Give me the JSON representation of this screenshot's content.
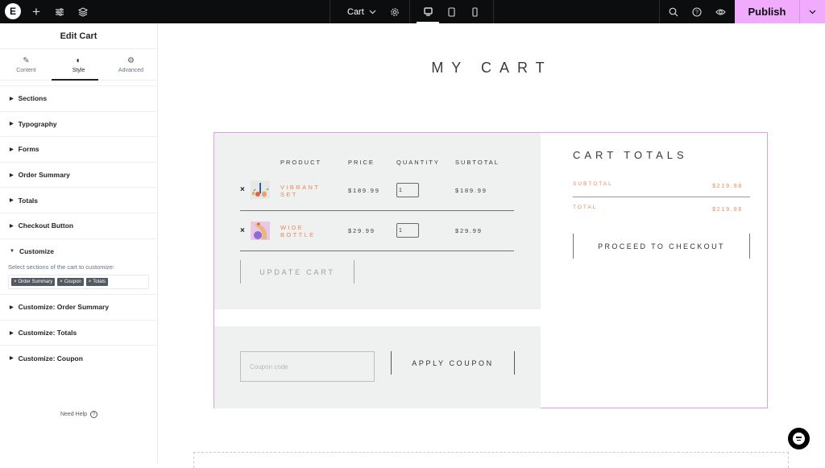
{
  "topbar": {
    "logo_letter": "E",
    "add_icon": "+",
    "document_title": "Cart",
    "publish_label": "Publish",
    "icons": {
      "add": "plus-icon",
      "site_settings": "sliders-icon",
      "structure": "layers-icon",
      "page_settings": "gear-icon",
      "desktop": "desktop-icon",
      "tablet": "tablet-icon",
      "mobile": "mobile-icon",
      "search": "search-icon",
      "help": "help-icon",
      "preview": "eye-icon",
      "publish_more": "chevron-down-icon"
    },
    "active_device": "desktop",
    "accent_color": "#f0abfc"
  },
  "sidebar": {
    "title": "Edit Cart",
    "tabs": [
      {
        "label": "Content",
        "icon": "pencil-icon",
        "active": false
      },
      {
        "label": "Style",
        "icon": "contrast-icon",
        "active": true
      },
      {
        "label": "Advanced",
        "icon": "gear-icon",
        "active": false
      }
    ],
    "sections": [
      {
        "label": "Sections",
        "expanded": false
      },
      {
        "label": "Typography",
        "expanded": false
      },
      {
        "label": "Forms",
        "expanded": false
      },
      {
        "label": "Order Summary",
        "expanded": false
      },
      {
        "label": "Totals",
        "expanded": false
      },
      {
        "label": "Checkout Button",
        "expanded": false
      },
      {
        "label": "Customize",
        "expanded": true
      }
    ],
    "customize": {
      "label": "Select sections of the cart to customize:",
      "chips": [
        "Order Summary",
        "Coupon",
        "Totals"
      ],
      "chip_remove": "×"
    },
    "sections_after": [
      {
        "label": "Customize: Order Summary",
        "expanded": false
      },
      {
        "label": "Customize: Totals",
        "expanded": false
      },
      {
        "label": "Customize: Coupon",
        "expanded": false
      }
    ],
    "need_help": "Need Help",
    "collapse_icon": "‹"
  },
  "page": {
    "heading": "MY CART",
    "cart": {
      "headers": [
        "PRODUCT",
        "PRICE",
        "QUANTITY",
        "SUBTOTAL"
      ],
      "items": [
        {
          "name_line1": "VIBRANT",
          "name_line2": "SET",
          "price": "$189.99",
          "quantity": "1",
          "subtotal": "$189.99"
        },
        {
          "name_line1": "WIDE",
          "name_line2": "BOTTLE",
          "price": "$29.99",
          "quantity": "1",
          "subtotal": "$29.99"
        }
      ],
      "remove_glyph": "×",
      "update_label": "UPDATE CART"
    },
    "coupon": {
      "placeholder": "Coupon code",
      "apply_label": "APPLY COUPON"
    },
    "totals": {
      "title": "CART TOTALS",
      "subtotal_label": "SUBTOTAL",
      "subtotal_value": "$219.98",
      "total_label": "TOTAL",
      "total_value": "$219.98",
      "checkout_label": "PROCEED TO CHECKOUT"
    },
    "colors": {
      "panel_bg": "#eef1f0",
      "accent": "#e8875a",
      "widget_outline": "#e39bf0"
    }
  }
}
